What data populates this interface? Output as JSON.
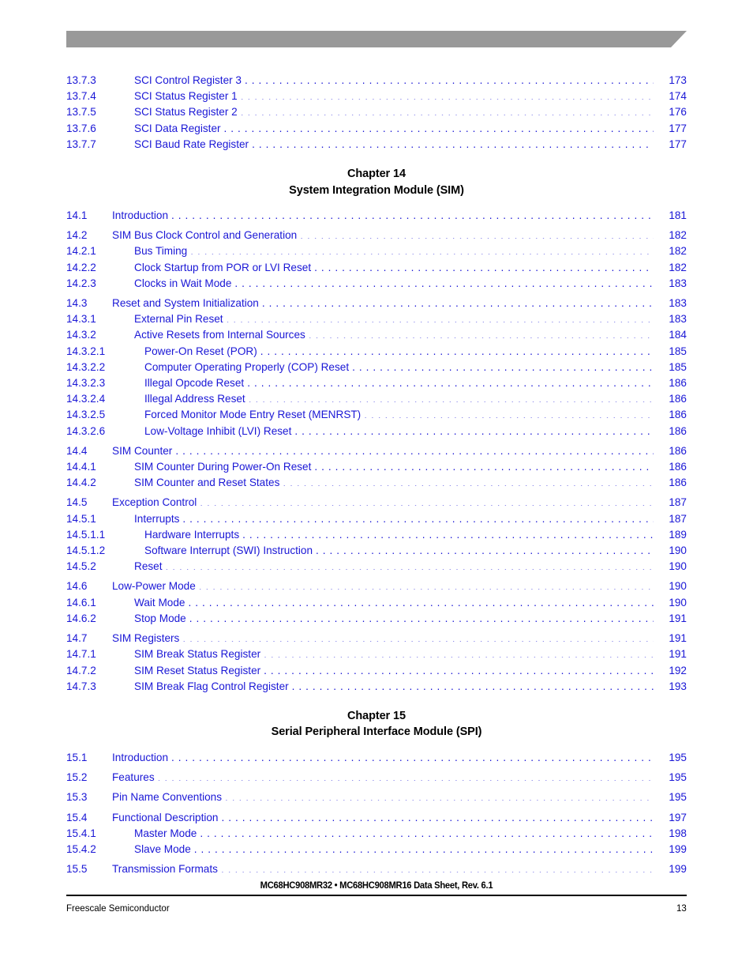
{
  "colors": {
    "link_blue": "#1a17d6",
    "header_bar_gray": "#999999",
    "text_black": "#000000"
  },
  "header": {
    "bar_icon": "angled-gray-banner"
  },
  "toc": {
    "leading_entries": [
      {
        "num": "13.7.3",
        "title": "SCI Control Register 3",
        "page": "173",
        "level": 3
      },
      {
        "num": "13.7.4",
        "title": "SCI Status Register 1",
        "page": "174",
        "level": 3
      },
      {
        "num": "13.7.5",
        "title": "SCI Status Register 2",
        "page": "176",
        "level": 3
      },
      {
        "num": "13.7.6",
        "title": "SCI Data Register",
        "page": "177",
        "level": 3
      },
      {
        "num": "13.7.7",
        "title": "SCI Baud Rate Register",
        "page": "177",
        "level": 3
      }
    ],
    "chapters": [
      {
        "number_label": "Chapter 14",
        "title": "System Integration Module (SIM)",
        "entries": [
          {
            "num": "14.1",
            "title": "Introduction",
            "page": "181",
            "level": 2,
            "gap": false
          },
          {
            "num": "14.2",
            "title": "SIM Bus Clock Control and Generation",
            "page": "182",
            "level": 2,
            "gap": true
          },
          {
            "num": "14.2.1",
            "title": "Bus Timing",
            "page": "182",
            "level": 3,
            "gap": false
          },
          {
            "num": "14.2.2",
            "title": "Clock Startup from POR or LVI Reset",
            "page": "182",
            "level": 3,
            "gap": false
          },
          {
            "num": "14.2.3",
            "title": "Clocks in Wait Mode",
            "page": "183",
            "level": 3,
            "gap": false
          },
          {
            "num": "14.3",
            "title": "Reset and System Initialization",
            "page": "183",
            "level": 2,
            "gap": true
          },
          {
            "num": "14.3.1",
            "title": "External Pin Reset",
            "page": "183",
            "level": 3,
            "gap": false
          },
          {
            "num": "14.3.2",
            "title": "Active Resets from Internal Sources",
            "page": "184",
            "level": 3,
            "gap": false
          },
          {
            "num": "14.3.2.1",
            "title": "Power-On Reset (POR)",
            "page": "185",
            "level": 4,
            "gap": false
          },
          {
            "num": "14.3.2.2",
            "title": "Computer Operating Properly (COP) Reset",
            "page": "185",
            "level": 4,
            "gap": false
          },
          {
            "num": "14.3.2.3",
            "title": "Illegal Opcode Reset",
            "page": "186",
            "level": 4,
            "gap": false
          },
          {
            "num": "14.3.2.4",
            "title": "Illegal Address Reset",
            "page": "186",
            "level": 4,
            "gap": false
          },
          {
            "num": "14.3.2.5",
            "title": "Forced Monitor Mode Entry Reset (MENRST)",
            "page": "186",
            "level": 4,
            "gap": false
          },
          {
            "num": "14.3.2.6",
            "title": "Low-Voltage Inhibit (LVI) Reset",
            "page": "186",
            "level": 4,
            "gap": false
          },
          {
            "num": "14.4",
            "title": "SIM Counter",
            "page": "186",
            "level": 2,
            "gap": true
          },
          {
            "num": "14.4.1",
            "title": "SIM Counter During Power-On Reset",
            "page": "186",
            "level": 3,
            "gap": false
          },
          {
            "num": "14.4.2",
            "title": "SIM Counter and Reset States",
            "page": "186",
            "level": 3,
            "gap": false
          },
          {
            "num": "14.5",
            "title": "Exception Control",
            "page": "187",
            "level": 2,
            "gap": true
          },
          {
            "num": "14.5.1",
            "title": "Interrupts",
            "page": "187",
            "level": 3,
            "gap": false
          },
          {
            "num": "14.5.1.1",
            "title": "Hardware Interrupts",
            "page": "189",
            "level": 4,
            "gap": false
          },
          {
            "num": "14.5.1.2",
            "title": "Software Interrupt (SWI) Instruction",
            "page": "190",
            "level": 4,
            "gap": false
          },
          {
            "num": "14.5.2",
            "title": "Reset",
            "page": "190",
            "level": 3,
            "gap": false
          },
          {
            "num": "14.6",
            "title": "Low-Power Mode",
            "page": "190",
            "level": 2,
            "gap": true
          },
          {
            "num": "14.6.1",
            "title": "Wait Mode",
            "page": "190",
            "level": 3,
            "gap": false
          },
          {
            "num": "14.6.2",
            "title": "Stop Mode",
            "page": "191",
            "level": 3,
            "gap": false
          },
          {
            "num": "14.7",
            "title": "SIM Registers",
            "page": "191",
            "level": 2,
            "gap": true
          },
          {
            "num": "14.7.1",
            "title": "SIM Break Status Register",
            "page": "191",
            "level": 3,
            "gap": false
          },
          {
            "num": "14.7.2",
            "title": "SIM Reset Status Register",
            "page": "192",
            "level": 3,
            "gap": false
          },
          {
            "num": "14.7.3",
            "title": "SIM Break Flag Control Register",
            "page": "193",
            "level": 3,
            "gap": false
          }
        ]
      },
      {
        "number_label": "Chapter 15",
        "title": "Serial Peripheral Interface Module (SPI)",
        "entries": [
          {
            "num": "15.1",
            "title": "Introduction",
            "page": "195",
            "level": 2,
            "gap": false
          },
          {
            "num": "15.2",
            "title": "Features",
            "page": "195",
            "level": 2,
            "gap": true
          },
          {
            "num": "15.3",
            "title": "Pin Name Conventions",
            "page": "195",
            "level": 2,
            "gap": true
          },
          {
            "num": "15.4",
            "title": "Functional Description",
            "page": "197",
            "level": 2,
            "gap": true
          },
          {
            "num": "15.4.1",
            "title": "Master Mode",
            "page": "198",
            "level": 3,
            "gap": false
          },
          {
            "num": "15.4.2",
            "title": "Slave Mode",
            "page": "199",
            "level": 3,
            "gap": false
          },
          {
            "num": "15.5",
            "title": "Transmission Formats",
            "page": "199",
            "level": 2,
            "gap": true
          }
        ]
      }
    ]
  },
  "footer": {
    "document_title": "MC68HC908MR32 • MC68HC908MR16 Data Sheet, Rev. 6.1",
    "company": "Freescale Semiconductor",
    "page_number": "13"
  }
}
